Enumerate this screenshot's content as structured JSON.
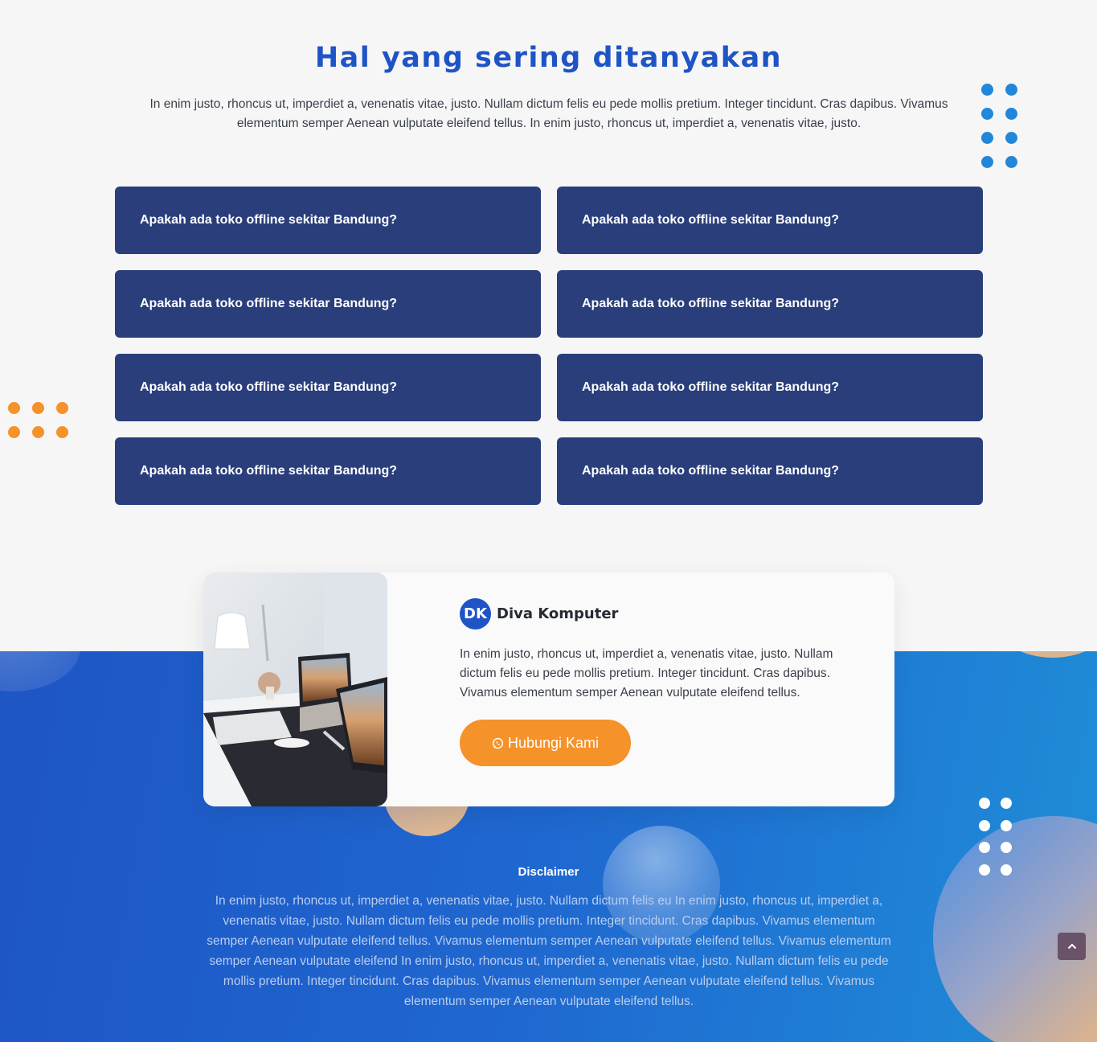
{
  "faq": {
    "title": "Hal yang sering ditanyakan",
    "intro": "In enim justo, rhoncus ut, imperdiet a, venenatis vitae, justo. Nullam dictum felis eu pede mollis pretium. Integer tincidunt. Cras dapibus. Vivamus elementum semper Aenean vulputate eleifend tellus. In enim justo, rhoncus ut, imperdiet a, venenatis vitae, justo.",
    "items": [
      {
        "question": "Apakah ada toko offline sekitar Bandung?"
      },
      {
        "question": "Apakah ada toko offline sekitar Bandung?"
      },
      {
        "question": "Apakah ada toko offline sekitar Bandung?"
      },
      {
        "question": "Apakah ada toko offline sekitar Bandung?"
      },
      {
        "question": "Apakah ada toko offline sekitar Bandung?"
      },
      {
        "question": "Apakah ada toko offline sekitar Bandung?"
      },
      {
        "question": "Apakah ada toko offline sekitar Bandung?"
      },
      {
        "question": "Apakah ada toko offline sekitar Bandung?"
      }
    ]
  },
  "contact_card": {
    "avatar_initials": "DK",
    "brand_name": "Diva Komputer",
    "description": "In enim justo, rhoncus ut, imperdiet a, venenatis vitae, justo. Nullam dictum felis eu pede mollis pretium. Integer tincidunt. Cras dapibus. Vivamus elementum semper Aenean vulputate eleifend tellus.",
    "button_label": "Hubungi Kami",
    "button_icon": "whatsapp-icon"
  },
  "disclaimer": {
    "title": "Disclaimer",
    "text": "In enim justo, rhoncus ut, imperdiet a, venenatis vitae, justo. Nullam dictum felis eu In enim justo, rhoncus ut, imperdiet a, venenatis vitae, justo. Nullam dictum felis eu pede mollis pretium. Integer tincidunt. Cras dapibus. Vivamus elementum semper Aenean vulputate eleifend tellus. Vivamus elementum semper Aenean vulputate eleifend tellus. Vivamus elementum semper Aenean vulputate eleifend In enim justo, rhoncus ut, imperdiet a, venenatis vitae, justo. Nullam dictum felis eu pede mollis pretium. Integer tincidunt. Cras dapibus. Vivamus elementum semper Aenean vulputate eleifend tellus. Vivamus elementum semper Aenean vulputate eleifend tellus."
  },
  "scroll_top": {
    "icon": "chevron-up-icon"
  },
  "colors": {
    "heading_blue": "#1f54c6",
    "faq_item_bg": "#293e7b",
    "accent_orange": "#f5922a",
    "dot_blue": "#2287d8",
    "footer_gradient_start": "#1e55c4",
    "footer_gradient_end": "#1f8ed8"
  }
}
